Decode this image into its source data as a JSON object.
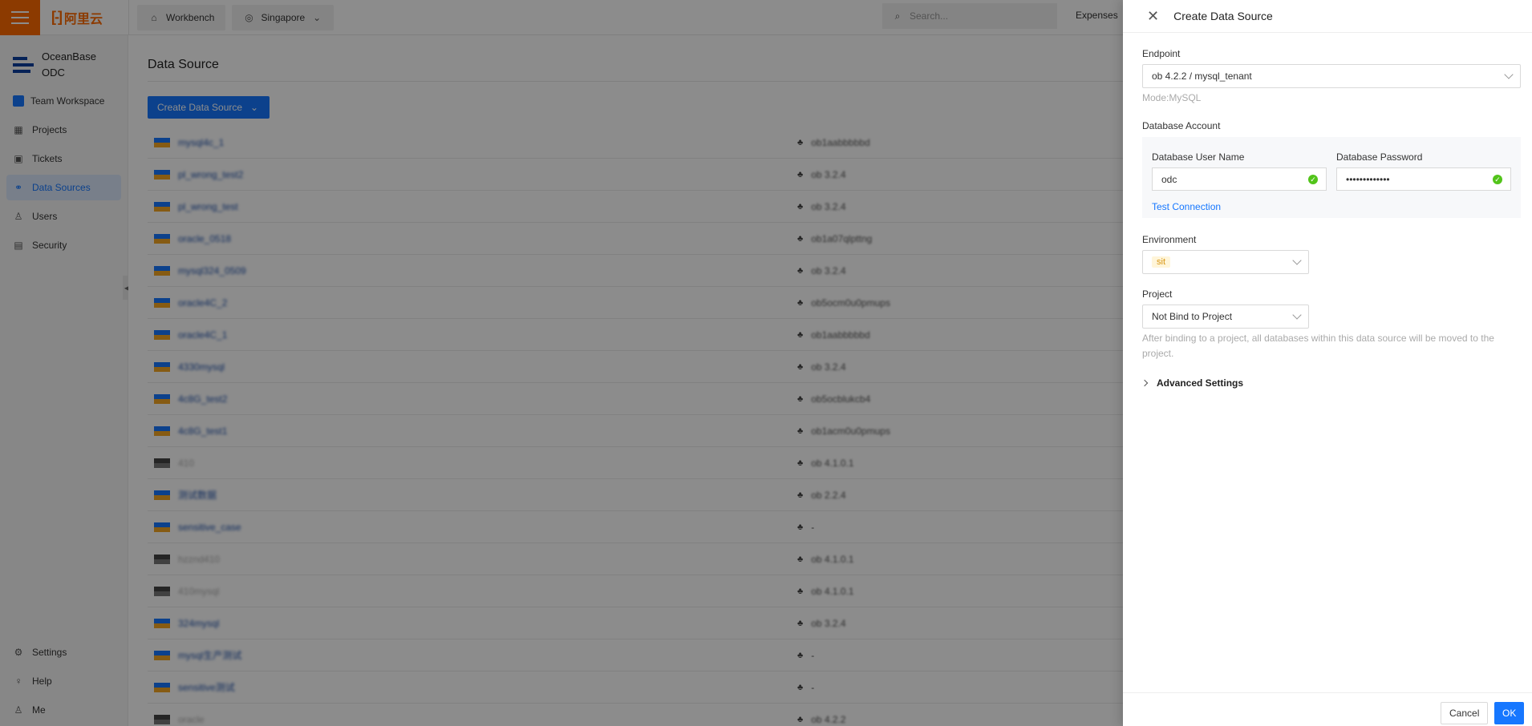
{
  "topbar": {
    "logo_text": "阿里云",
    "workbench": "Workbench",
    "region": "Singapore",
    "search_placeholder": "Search...",
    "expenses": "Expenses"
  },
  "sidebar": {
    "brand_line1": "OceanBase",
    "brand_line2": "ODC",
    "workspace": "Team Workspace",
    "items": [
      {
        "label": "Projects",
        "icon": "grid-icon"
      },
      {
        "label": "Tickets",
        "icon": "briefcase-icon"
      },
      {
        "label": "Data Sources",
        "icon": "link-icon",
        "active": true
      },
      {
        "label": "Users",
        "icon": "user-icon"
      },
      {
        "label": "Security",
        "icon": "shield-list-icon"
      }
    ],
    "bottom": [
      {
        "label": "Settings",
        "icon": "gear-icon"
      },
      {
        "label": "Help",
        "icon": "lightbulb-icon"
      },
      {
        "label": "Me",
        "icon": "user-icon"
      }
    ]
  },
  "main": {
    "title": "Data Source",
    "create_button": "Create Data Source",
    "rows": [
      {
        "name": "mysql4c_1",
        "ver": "ob1aabbbbbd",
        "gray": false
      },
      {
        "name": "pl_wrong_test2",
        "ver": "ob 3.2.4",
        "gray": false
      },
      {
        "name": "pl_wrong_test",
        "ver": "ob 3.2.4",
        "gray": false
      },
      {
        "name": "oracle_0518",
        "ver": "ob1a07qlpttng",
        "gray": false
      },
      {
        "name": "mysql324_0509",
        "ver": "ob 3.2.4",
        "gray": false
      },
      {
        "name": "oracle4C_2",
        "ver": "ob5ocm0u0pmups",
        "gray": false
      },
      {
        "name": "oracle4C_1",
        "ver": "ob1aabbbbbd",
        "gray": false
      },
      {
        "name": "4330mysql",
        "ver": "ob 3.2.4",
        "gray": false
      },
      {
        "name": "4c8G_test2",
        "ver": "ob5ocblukcb4",
        "gray": false
      },
      {
        "name": "4c8G_test1",
        "ver": "ob1acm0u0pmups",
        "gray": false
      },
      {
        "name": "410",
        "ver": "ob 4.1.0.1",
        "gray": true
      },
      {
        "name": "测试数据",
        "ver": "ob 2.2.4",
        "gray": false
      },
      {
        "name": "sensitive_case",
        "ver": "-",
        "gray": false
      },
      {
        "name": "hzznd410",
        "ver": "ob 4.1.0.1",
        "gray": true
      },
      {
        "name": "410mysql",
        "ver": "ob 4.1.0.1",
        "gray": true
      },
      {
        "name": "324mysql",
        "ver": "ob 3.2.4",
        "gray": false
      },
      {
        "name": "mysql生产测试",
        "ver": "-",
        "gray": false
      },
      {
        "name": "sensitive测试",
        "ver": "-",
        "gray": false
      },
      {
        "name": "oracle",
        "ver": "ob 4.2.2",
        "gray": true
      }
    ]
  },
  "drawer": {
    "title": "Create Data Source",
    "endpoint_label": "Endpoint",
    "endpoint_value": "ob 4.2.2 / mysql_tenant",
    "mode_text": "Mode:MySQL",
    "account_label": "Database Account",
    "username_label": "Database User Name",
    "username_value": "odc",
    "password_label": "Database Password",
    "password_value": "•••••••••••••",
    "test_connection": "Test Connection",
    "environment_label": "Environment",
    "environment_value": "sit",
    "project_label": "Project",
    "project_value": "Not Bind to Project",
    "project_help": "After binding to a project, all databases within this data source will be moved to the project.",
    "advanced": "Advanced Settings",
    "cancel": "Cancel",
    "ok": "OK"
  },
  "colors": {
    "brand_orange": "#ff6a00",
    "primary_blue": "#1677ff",
    "success_green": "#52c41a",
    "sit_tag": "#d89614"
  }
}
